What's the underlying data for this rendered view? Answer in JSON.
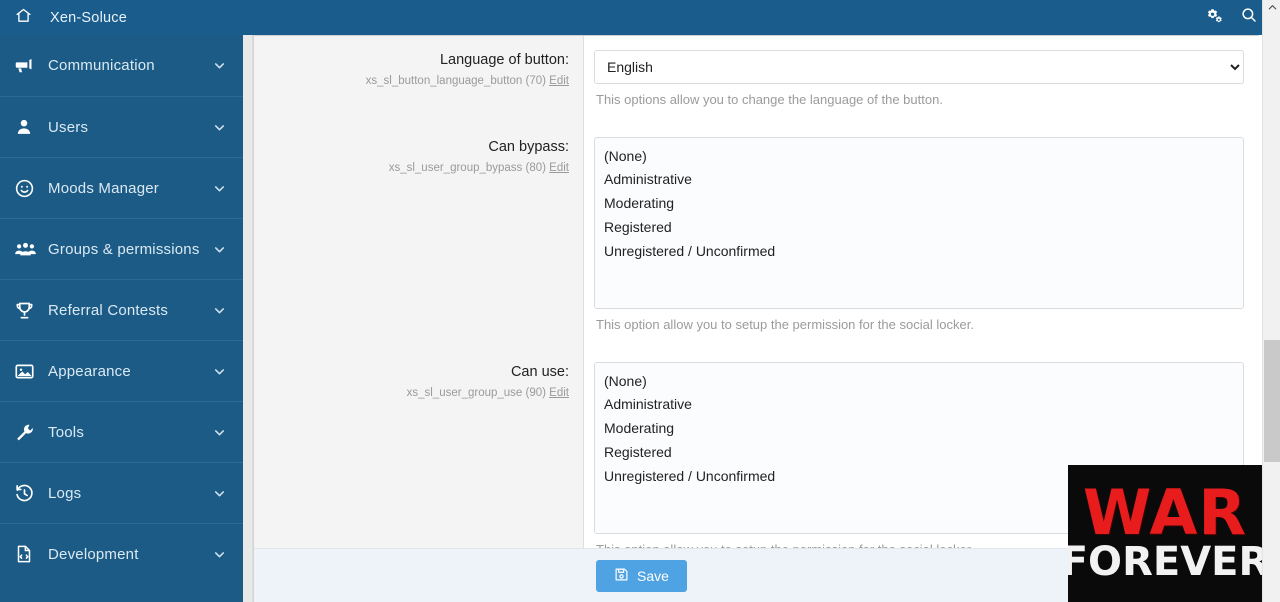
{
  "topbar": {
    "home_icon": "home-icon",
    "title": "Xen-Soluce",
    "gears_icon": "gears-icon",
    "search_icon": "search-icon"
  },
  "sidebar": {
    "items": [
      {
        "label": "Communication",
        "icon": "megaphone-icon",
        "chevron": "chevron-down-icon"
      },
      {
        "label": "Users",
        "icon": "user-icon",
        "chevron": "chevron-down-icon"
      },
      {
        "label": "Moods Manager",
        "icon": "smiley-icon",
        "chevron": "chevron-down-icon"
      },
      {
        "label": "Groups & permissions",
        "icon": "users-group-icon",
        "chevron": "chevron-down-icon"
      },
      {
        "label": "Referral Contests",
        "icon": "trophy-icon",
        "chevron": "chevron-down-icon"
      },
      {
        "label": "Appearance",
        "icon": "image-icon",
        "chevron": "chevron-down-icon"
      },
      {
        "label": "Tools",
        "icon": "wrench-icon",
        "chevron": "chevron-down-icon"
      },
      {
        "label": "Logs",
        "icon": "history-icon",
        "chevron": "chevron-down-icon"
      },
      {
        "label": "Development",
        "icon": "file-code-icon",
        "chevron": "chevron-down-icon"
      }
    ]
  },
  "form": {
    "rows": [
      {
        "label": "Language of button:",
        "phrase": "xs_sl_button_language_button (70)",
        "edit": "Edit",
        "control": "select",
        "value": "English",
        "options": [
          "English"
        ],
        "hint": "This options allow you to change the language of the button."
      },
      {
        "label": "Can bypass:",
        "phrase": "xs_sl_user_group_bypass (80)",
        "edit": "Edit",
        "control": "multiselect",
        "options": [
          "(None)",
          "Administrative",
          "Moderating",
          "Registered",
          "Unregistered / Unconfirmed"
        ],
        "hint": "This option allow you to setup the permission for the social locker."
      },
      {
        "label": "Can use:",
        "phrase": "xs_sl_user_group_use (90)",
        "edit": "Edit",
        "control": "multiselect",
        "options": [
          "(None)",
          "Administrative",
          "Moderating",
          "Registered",
          "Unregistered / Unconfirmed"
        ],
        "hint": "This option allow you to setup the permission for the social locker."
      }
    ]
  },
  "footer": {
    "save_label": "Save",
    "save_icon": "floppy-disk-icon"
  },
  "overlay_ad": {
    "line1": "WAR",
    "line2": "FOREVER"
  },
  "scrollbar": {
    "up_arrow_icon": "chevron-up-icon"
  },
  "colors": {
    "header_blue": "#1a5c8c",
    "sidebar_blue": "#1b5b86",
    "save_button_blue": "#4fa3e3",
    "footer_blue": "#eef3fa",
    "ad_red": "#e81c1c"
  }
}
